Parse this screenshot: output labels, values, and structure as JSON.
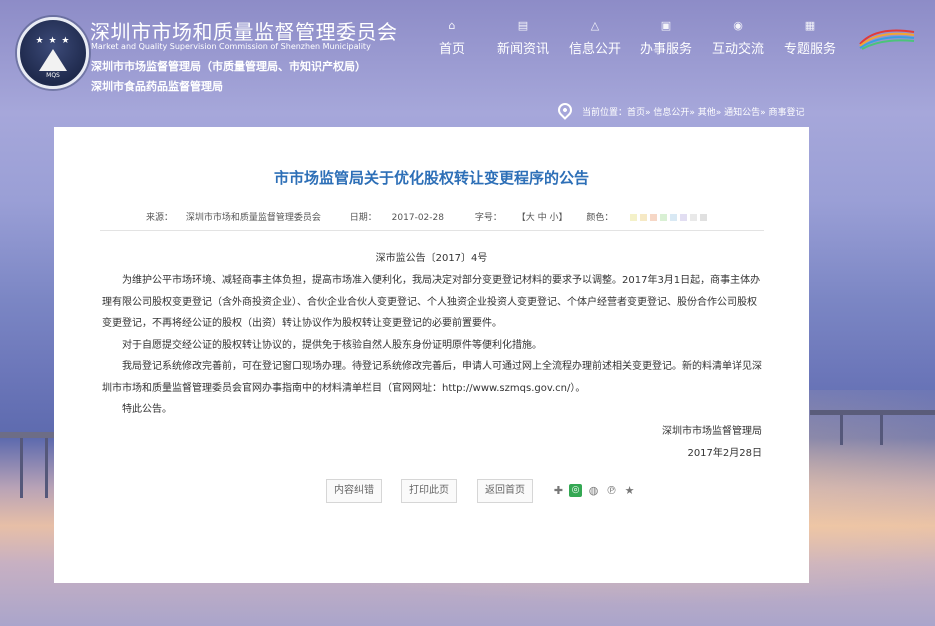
{
  "header": {
    "title_cn": "深圳市市场和质量监督管理委员会",
    "title_en": "Market and Quality Supervision Commission of Shenzhen Municipality",
    "sub1": "深圳市市场监督管理局（市质量管理局、市知识产权局）",
    "sub2": "深圳市食品药品监督管理局",
    "logo_text": "MQS"
  },
  "nav": [
    {
      "label": "首页",
      "icon": "home-icon"
    },
    {
      "label": "新闻资讯",
      "icon": "news-icon"
    },
    {
      "label": "信息公开",
      "icon": "network-icon"
    },
    {
      "label": "办事服务",
      "icon": "briefcase-icon"
    },
    {
      "label": "互动交流",
      "icon": "chat-icon"
    },
    {
      "label": "专题服务",
      "icon": "grid-icon"
    }
  ],
  "breadcrumb": "当前位置：首页» 信息公开» 其他» 通知公告» 商事登记",
  "article": {
    "title": "市市场监管局关于优化股权转让变更程序的公告",
    "source_label": "来源：",
    "source": "深圳市市场和质量监督管理委员会",
    "date_label": "日期：",
    "date": "2017-02-28",
    "font_label": "字号：",
    "font_sizes": "【大  中  小】",
    "color_label": "颜色：",
    "doc_no": "深市监公告〔2017〕4号",
    "paragraphs": [
      "为维护公平市场环境、减轻商事主体负担，提高市场准入便利化，我局决定对部分变更登记材料的要求予以调整。2017年3月1日起，商事主体办理有限公司股权变更登记（含外商投资企业）、合伙企业合伙人变更登记、个人独资企业投资人变更登记、个体户经营者变更登记、股份合作公司股权变更登记，不再将经公证的股权（出资）转让协议作为股权转让变更登记的必要前置要件。",
      "对于自愿提交经公证的股权转让协议的，提供免于核验自然人股东身份证明原件等便利化措施。",
      "我局登记系统修改完善前，可在登记窗口现场办理。待登记系统修改完善后，申请人可通过网上全流程办理前述相关变更登记。新的料清单详见深圳市市场和质量监督管理委员会官网办事指南中的材料清单栏目（官网网址：http://www.szmqs.gov.cn/）。",
      "特此公告。"
    ],
    "signature": "深圳市市场监督管理局",
    "sign_date": "2017年2月28日"
  },
  "buttons": {
    "correct": "内容纠错",
    "print": "打印此页",
    "back": "返回首页"
  },
  "swatch_colors": [
    "#f4f1c9",
    "#f6e9c5",
    "#f6d7c6",
    "#d9f0d4",
    "#d9e9f4",
    "#e2def2",
    "#e9e9e9",
    "#e0e0e0"
  ]
}
